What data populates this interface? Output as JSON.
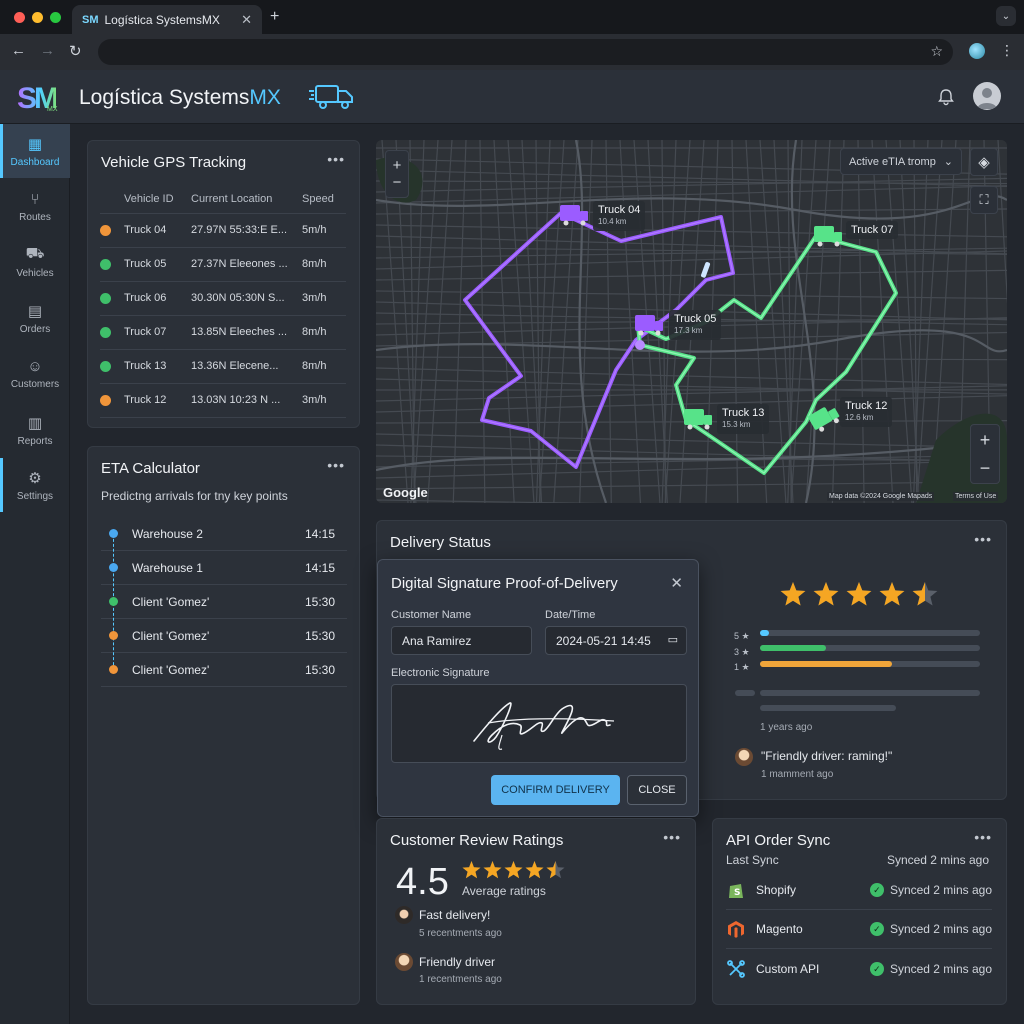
{
  "browser": {
    "tab_title": "Logística SystemsMX",
    "tab_favicon": "SM",
    "tab_close": "✕",
    "new_tab": "+"
  },
  "header": {
    "logo_text": "SM",
    "logo_small": "MX",
    "brand_name": "Logística Systems",
    "brand_suffix": "MX"
  },
  "sidebar": {
    "items": [
      {
        "label": "Dashboard",
        "icon": "dashboard-icon"
      },
      {
        "label": "Routes",
        "icon": "routes-icon"
      },
      {
        "label": "Vehicles",
        "icon": "vehicles-icon"
      },
      {
        "label": "Orders",
        "icon": "orders-icon"
      },
      {
        "label": "Customers",
        "icon": "customers-icon"
      },
      {
        "label": "Reports",
        "icon": "reports-icon"
      },
      {
        "label": "Settings",
        "icon": "settings-icon"
      }
    ]
  },
  "gps": {
    "title": "Vehicle GPS Tracking",
    "menu": "•••",
    "columns": [
      "Vehicle ID",
      "Current Location",
      "Speed"
    ],
    "rows": [
      {
        "id": "Truck 04",
        "location": "27.97N 55:33:E E...",
        "speed": "5m/h",
        "status": "#f0953a"
      },
      {
        "id": "Truck 05",
        "location": "27.37N Eleeones ...",
        "speed": "8m/h",
        "status": "#3fbf6a"
      },
      {
        "id": "Truck 06",
        "location": "30.30N 05:30N S...",
        "speed": "3m/h",
        "status": "#3fbf6a"
      },
      {
        "id": "Truck 07",
        "location": "13.85N Eleeches ...",
        "speed": "8m/h",
        "status": "#3fbf6a"
      },
      {
        "id": "Truck 13",
        "location": "13.36N Elecene...",
        "speed": "8m/h",
        "status": "#3fbf6a"
      },
      {
        "id": "Truck 12",
        "location": "13.03N 10:23 N ...",
        "speed": "3m/h",
        "status": "#f0953a"
      }
    ]
  },
  "eta": {
    "title": "ETA Calculator",
    "menu": "•••",
    "subtitle": "Predictng arrivals for tny key points",
    "rows": [
      {
        "place": "Warehouse 2",
        "time": "14:15",
        "color": "#4aa8f0"
      },
      {
        "place": "Warehouse 1",
        "time": "14:15",
        "color": "#4aa8f0"
      },
      {
        "place": "Client 'Gomez'",
        "time": "15:30",
        "color": "#3fbf6a"
      },
      {
        "place": "Client 'Gomez'",
        "time": "15:30",
        "color": "#f0953a"
      },
      {
        "place": "Client 'Gomez'",
        "time": "15:30",
        "color": "#f0953a"
      }
    ]
  },
  "map": {
    "dropdown": "Active eTIA tromp",
    "google": "Google",
    "attribution": "Map data ©2024 Google Mapads",
    "terms": "Terms of Use",
    "zoom_in": "+",
    "zoom_out": "−",
    "trucks": [
      {
        "name": "Truck 04",
        "km": "10.4 km"
      },
      {
        "name": "Truck 07",
        "km": ""
      },
      {
        "name": "Truck 05",
        "km": "17.3 km"
      },
      {
        "name": "Truck 13",
        "km": "15.3 km"
      },
      {
        "name": "Truck 12",
        "km": "12.6 km"
      }
    ]
  },
  "delivery": {
    "title": "Delivery Status",
    "menu": "•••",
    "stars": 4.5,
    "bars": [
      {
        "label": "5 ★",
        "value": 0.04,
        "color": "#55c8ff"
      },
      {
        "label": "3 ★",
        "value": 0.3,
        "color": "#3fbf6a"
      },
      {
        "label": "1 ★",
        "value": 0.6,
        "color": "#f0a53a"
      }
    ],
    "time_ago": "1 years ago",
    "quote": "\"Friendly driver: raming!\"",
    "quote_time": "1 mamment ago"
  },
  "modal": {
    "title": "Digital Signature Proof-of-Delivery",
    "close_x": "✕",
    "customer_label": "Customer Name",
    "customer_value": "Ana Ramirez",
    "date_label": "Date/Time",
    "date_value": "2024-05-21 14:45",
    "signature_label": "Electronic Signature",
    "confirm": "CONFIRM DELIVERY",
    "close": "CLOSE"
  },
  "reviews": {
    "title": "Customer Review Ratings",
    "menu": "•••",
    "score": "4.5",
    "stars": 4.5,
    "caption": "Average ratings",
    "items": [
      {
        "text": "Fast delivery!",
        "meta": "5 recentments ago"
      },
      {
        "text": "Friendly driver",
        "meta": "1 recentments ago"
      }
    ]
  },
  "api": {
    "title": "API Order Sync",
    "menu": "•••",
    "last_sync_label": "Last Sync",
    "last_sync_value": "Synced 2 mins ago",
    "rows": [
      {
        "name": "Shopify",
        "status": "Synced 2 mins ago",
        "icon": "shopify-icon"
      },
      {
        "name": "Magento",
        "status": "Synced 2 mins ago",
        "icon": "magento-icon"
      },
      {
        "name": "Custom API",
        "status": "Synced 2 mins ago",
        "icon": "custom-api-icon"
      }
    ]
  }
}
